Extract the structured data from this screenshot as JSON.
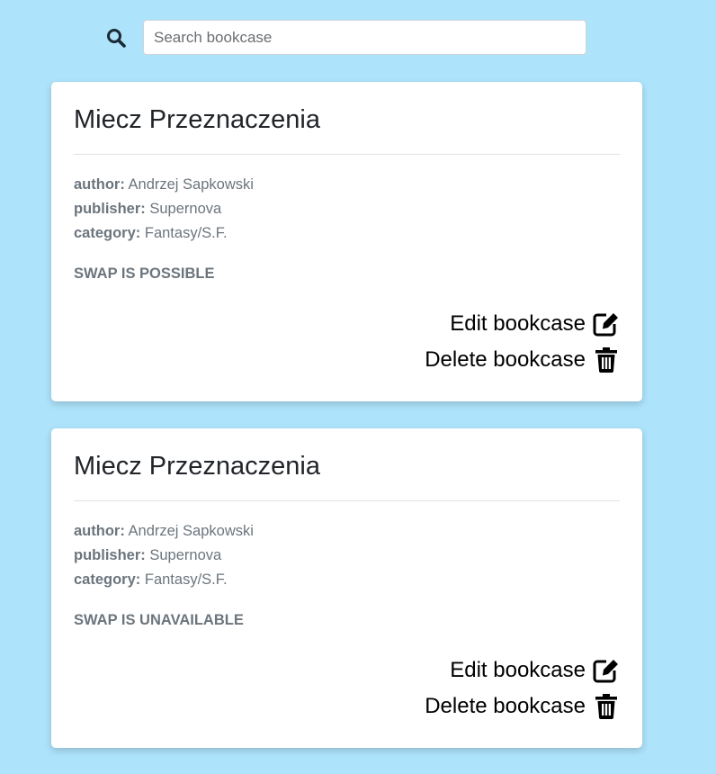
{
  "search": {
    "placeholder": "Search bookcase",
    "value": ""
  },
  "labels": {
    "author": "author:",
    "publisher": "publisher:",
    "category": "category:",
    "edit": "Edit bookcase",
    "delete": "Delete bookcase"
  },
  "cards": [
    {
      "title": "Miecz Przeznaczenia",
      "author": "Andrzej Sapkowski",
      "publisher": "Supernova",
      "category": "Fantasy/S.F.",
      "swap": "SWAP IS POSSIBLE"
    },
    {
      "title": "Miecz Przeznaczenia",
      "author": "Andrzej Sapkowski",
      "publisher": "Supernova",
      "category": "Fantasy/S.F.",
      "swap": "SWAP IS UNAVAILABLE"
    }
  ],
  "icons": {
    "search": "search-icon",
    "edit": "edit-icon",
    "delete": "trash-icon"
  },
  "colors": {
    "background": "#ade3fb",
    "card": "#ffffff",
    "muted_text": "#6c757d",
    "title_text": "#212529"
  }
}
